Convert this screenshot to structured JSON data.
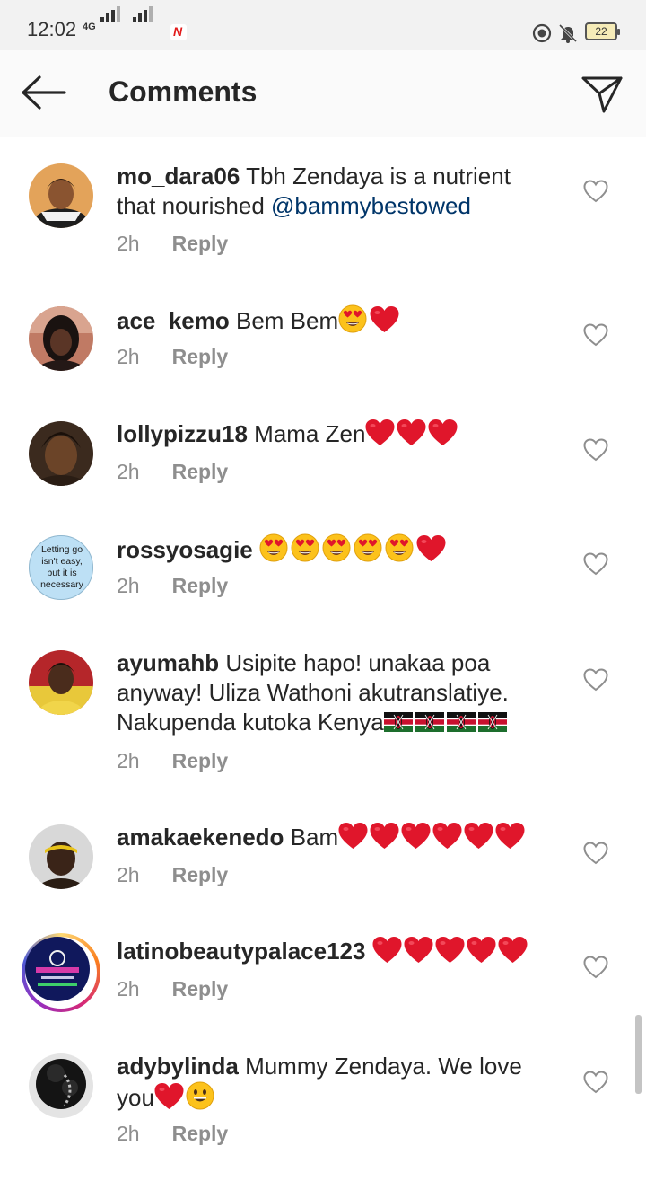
{
  "status_bar": {
    "time": "12:02",
    "network": "4G",
    "battery": "22"
  },
  "header": {
    "title": "Comments"
  },
  "comments": [
    {
      "user": "mo_dara06",
      "text": "Tbh Zendaya is a nutrient that nourished",
      "mention": "@bammybestowed",
      "time": "2h",
      "reply": "Reply"
    },
    {
      "user": "ace_kemo",
      "text": "Bem Bem",
      "emoji": [
        "heart-eyes-emoji",
        "red-heart-emoji"
      ],
      "time": "2h",
      "reply": "Reply"
    },
    {
      "user": "lollypizzu18",
      "text": "Mama Zen",
      "emoji": [
        "red-heart-emoji",
        "red-heart-emoji",
        "red-heart-emoji"
      ],
      "time": "2h",
      "reply": "Reply"
    },
    {
      "user": "rossyosagie",
      "text": "",
      "emoji": [
        "heart-eyes-emoji",
        "heart-eyes-emoji",
        "heart-eyes-emoji",
        "heart-eyes-emoji",
        "heart-eyes-emoji",
        "red-heart-emoji"
      ],
      "avatar_text": [
        "Letting go",
        "isn't easy,",
        "but it is",
        "necessary"
      ],
      "time": "2h",
      "reply": "Reply"
    },
    {
      "user": "ayumahb",
      "text": "Usipite hapo!  unakaa poa anyway! Uliza Wathoni akutranslatiye. Nakupenda kutoka Kenya",
      "emoji": [
        "kenya-flag-emoji",
        "kenya-flag-emoji",
        "kenya-flag-emoji",
        "kenya-flag-emoji"
      ],
      "time": "2h",
      "reply": "Reply"
    },
    {
      "user": "amakaekenedo",
      "text": "Bam",
      "emoji": [
        "red-heart-emoji",
        "red-heart-emoji",
        "red-heart-emoji",
        "red-heart-emoji",
        "red-heart-emoji",
        "red-heart-emoji"
      ],
      "time": "2h",
      "reply": "Reply"
    },
    {
      "user": "latinobeautypalace123",
      "text": "",
      "emoji": [
        "red-heart-emoji",
        "red-heart-emoji",
        "red-heart-emoji",
        "red-heart-emoji",
        "red-heart-emoji"
      ],
      "time": "2h",
      "reply": "Reply"
    },
    {
      "user": "adybylinda",
      "text": "Mummy Zendaya. We love you",
      "emoji": [
        "red-heart-emoji",
        "grinning-emoji"
      ],
      "time": "2h",
      "reply": "Reply"
    }
  ],
  "colors": {
    "heart": "#e0162b",
    "mention": "#003569",
    "meta": "#8e8e8e"
  }
}
